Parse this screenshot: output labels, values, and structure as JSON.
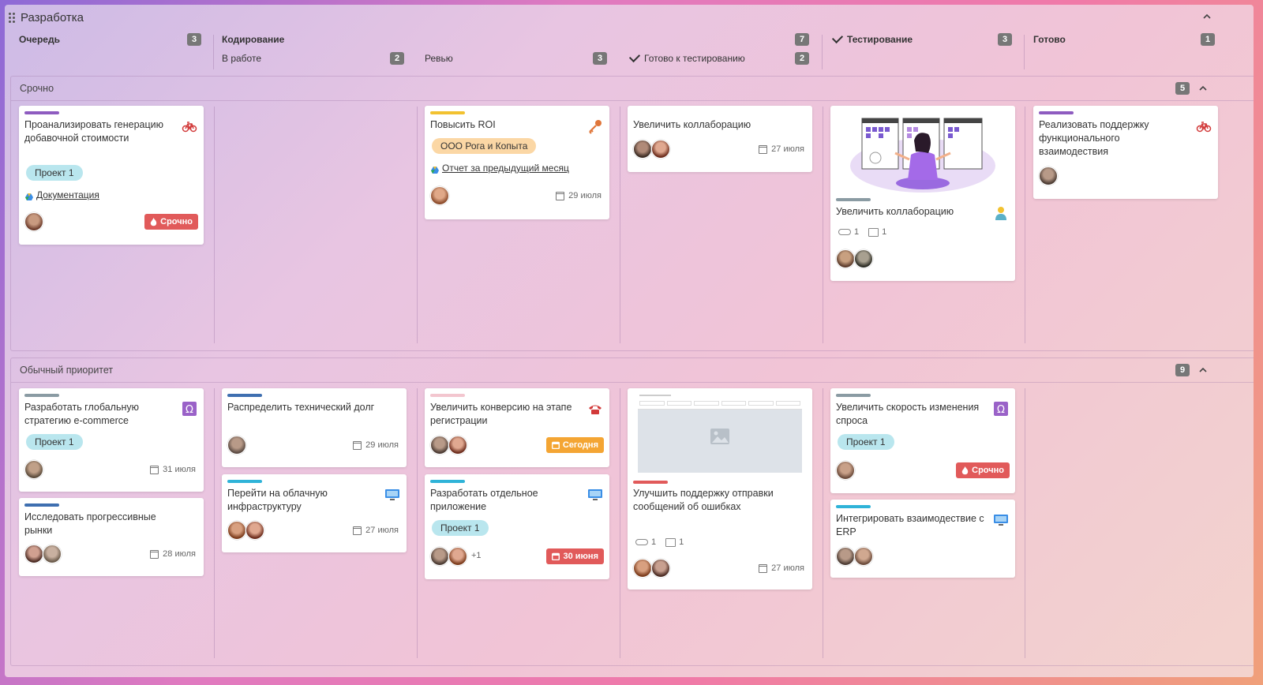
{
  "board": {
    "title": "Разработка"
  },
  "columns": {
    "queue": {
      "label": "Очередь",
      "count": "3"
    },
    "coding": {
      "label": "Кодирование",
      "count": "7"
    },
    "in_progress": {
      "label": "В работе",
      "count": "2"
    },
    "review": {
      "label": "Ревью",
      "count": "3"
    },
    "ready_test": {
      "label": "Готово к тестированию",
      "count": "2"
    },
    "testing": {
      "label": "Тестирование",
      "count": "3"
    },
    "done": {
      "label": "Готово",
      "count": "1"
    }
  },
  "lanes": {
    "urgent": {
      "title": "Срочно",
      "count": "5"
    },
    "normal": {
      "title": "Обычный приоритет",
      "count": "9"
    }
  },
  "cards": {
    "c1": {
      "title": "Проанализировать генерацию добавочной стоимости",
      "tag": "Проект 1",
      "link": "Документация",
      "badge": "Срочно",
      "bar": "#8e5cc0",
      "icon": "bicycle-icon"
    },
    "c2": {
      "title": "Повысить ROI",
      "tag": "ООО Рога и Копыта",
      "link": "Отчет за предыдущий месяц",
      "date": "29 июля",
      "bar": "#f2c230",
      "icon": "key-icon"
    },
    "c3": {
      "title": "Увеличить коллаборацию",
      "date": "27 июля"
    },
    "c4": {
      "title": "Увеличить коллаборацию",
      "attach": "1",
      "comments": "1",
      "bar": "#8a9ba3",
      "icon": "person-icon"
    },
    "c5": {
      "title": "Реализовать поддержку функционального взаимодествия",
      "bar": "#8e5cc0",
      "icon": "bicycle-icon"
    },
    "n1": {
      "title": "Разработать глобальную стратегию e-commerce",
      "tag": "Проект 1",
      "date": "31 июля",
      "bar": "#8a9ba3",
      "icon": "omega-icon"
    },
    "n2": {
      "title": "Исследовать прогрессивные рынки",
      "date": "28 июля",
      "bar": "#3e6fb0"
    },
    "n3": {
      "title": "Распределить технический долг",
      "date": "29 июля",
      "bar": "#3e6fb0"
    },
    "n4": {
      "title": "Перейти на облачную инфраструктуру",
      "date": "27 июля",
      "bar": "#2fb3d8",
      "icon": "monitor-icon"
    },
    "n5": {
      "title": "Увеличить конверсию на этапе регистрации",
      "badge": "Сегодня",
      "bar": "#f3c6cf",
      "icon": "phone-icon"
    },
    "n6": {
      "title": "Разработать отдельное приложение",
      "tag": "Проект 1",
      "more": "+1",
      "badge": "30 июня",
      "bar": "#2fb3d8",
      "icon": "monitor-icon"
    },
    "n7": {
      "title": "Улучшить поддержку отправки сообщений об ошибках",
      "attach": "1",
      "comments": "1",
      "date": "27 июля",
      "bar": "#e15a5a"
    },
    "n8": {
      "title": "Увеличить скорость изменения спроса",
      "tag": "Проект 1",
      "badge": "Срочно",
      "bar": "#8a9ba3",
      "icon": "omega-icon"
    },
    "n9": {
      "title": "Интегрировать взаимодествие с ERP",
      "bar": "#2fb3d8",
      "icon": "monitor-icon"
    }
  },
  "colors": {
    "accent_red": "#e15a5a",
    "accent_orange": "#f4a533",
    "badge_gray": "#777777"
  }
}
